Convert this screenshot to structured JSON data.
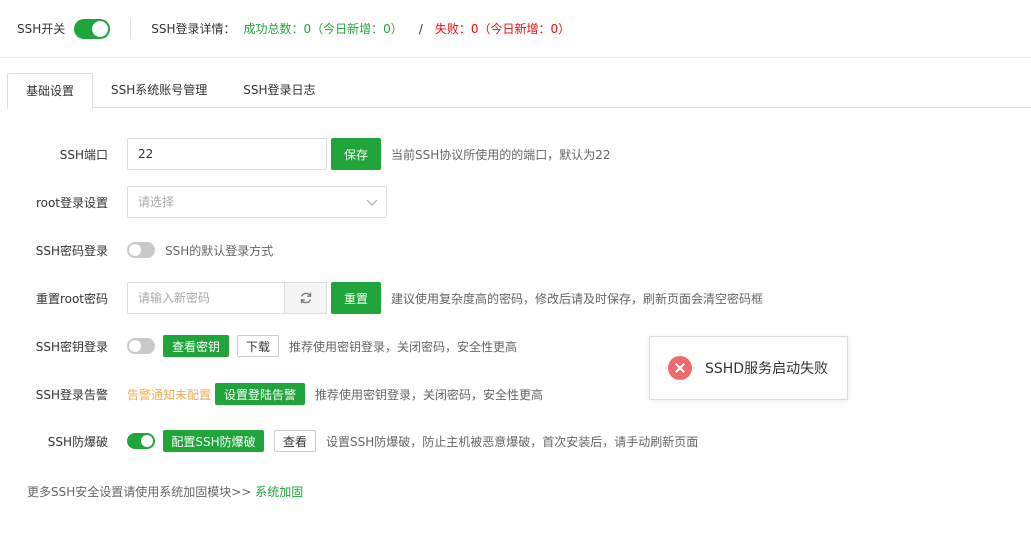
{
  "header": {
    "ssh_switch_label": "SSH开关",
    "ssh_switch_on": true,
    "login_detail_label": "SSH登录详情：",
    "success_text": "成功总数：0（今日新增：0）",
    "separator": "/",
    "fail_text": "失败：0（今日新增：0）"
  },
  "tabs": [
    {
      "label": "基础设置",
      "active": true
    },
    {
      "label": "SSH系统账号管理",
      "active": false
    },
    {
      "label": "SSH登录日志",
      "active": false
    }
  ],
  "form": {
    "port": {
      "label": "SSH端口",
      "value": "22",
      "save_button": "保存",
      "hint": "当前SSH协议所使用的的端口，默认为22"
    },
    "root_login": {
      "label": "root登录设置",
      "placeholder": "请选择"
    },
    "password_login": {
      "label": "SSH密码登录",
      "enabled": false,
      "hint": "SSH的默认登录方式"
    },
    "reset_root": {
      "label": "重置root密码",
      "placeholder": "请输入新密码",
      "reset_button": "重置",
      "hint": "建议使用复杂度高的密码，修改后请及时保存，刷新页面会清空密码框"
    },
    "key_login": {
      "label": "SSH密钥登录",
      "enabled": false,
      "view_button": "查看密钥",
      "download_button": "下载",
      "hint": "推荐使用密钥登录，关闭密码，安全性更高"
    },
    "login_alert": {
      "label": "SSH登录告警",
      "status": "告警通知未配置",
      "config_button": "设置登陆告警",
      "hint": "推荐使用密钥登录，关闭密码，安全性更高"
    },
    "brute_force": {
      "label": "SSH防爆破",
      "enabled": true,
      "config_button": "配置SSH防爆破",
      "view_button": "查看",
      "hint": "设置SSH防爆破，防止主机被恶意爆破，首次安装后，请手动刷新页面"
    }
  },
  "footer": {
    "text": "更多SSH安全设置请使用系统加固模块>> ",
    "link": "系统加固"
  },
  "toast": {
    "message": "SSHD服务启动失败",
    "type": "error"
  },
  "colors": {
    "accent": "#20a53a",
    "error": "#ef0808",
    "warning": "#f0ad4e",
    "error_icon": "#ef6b6b"
  }
}
